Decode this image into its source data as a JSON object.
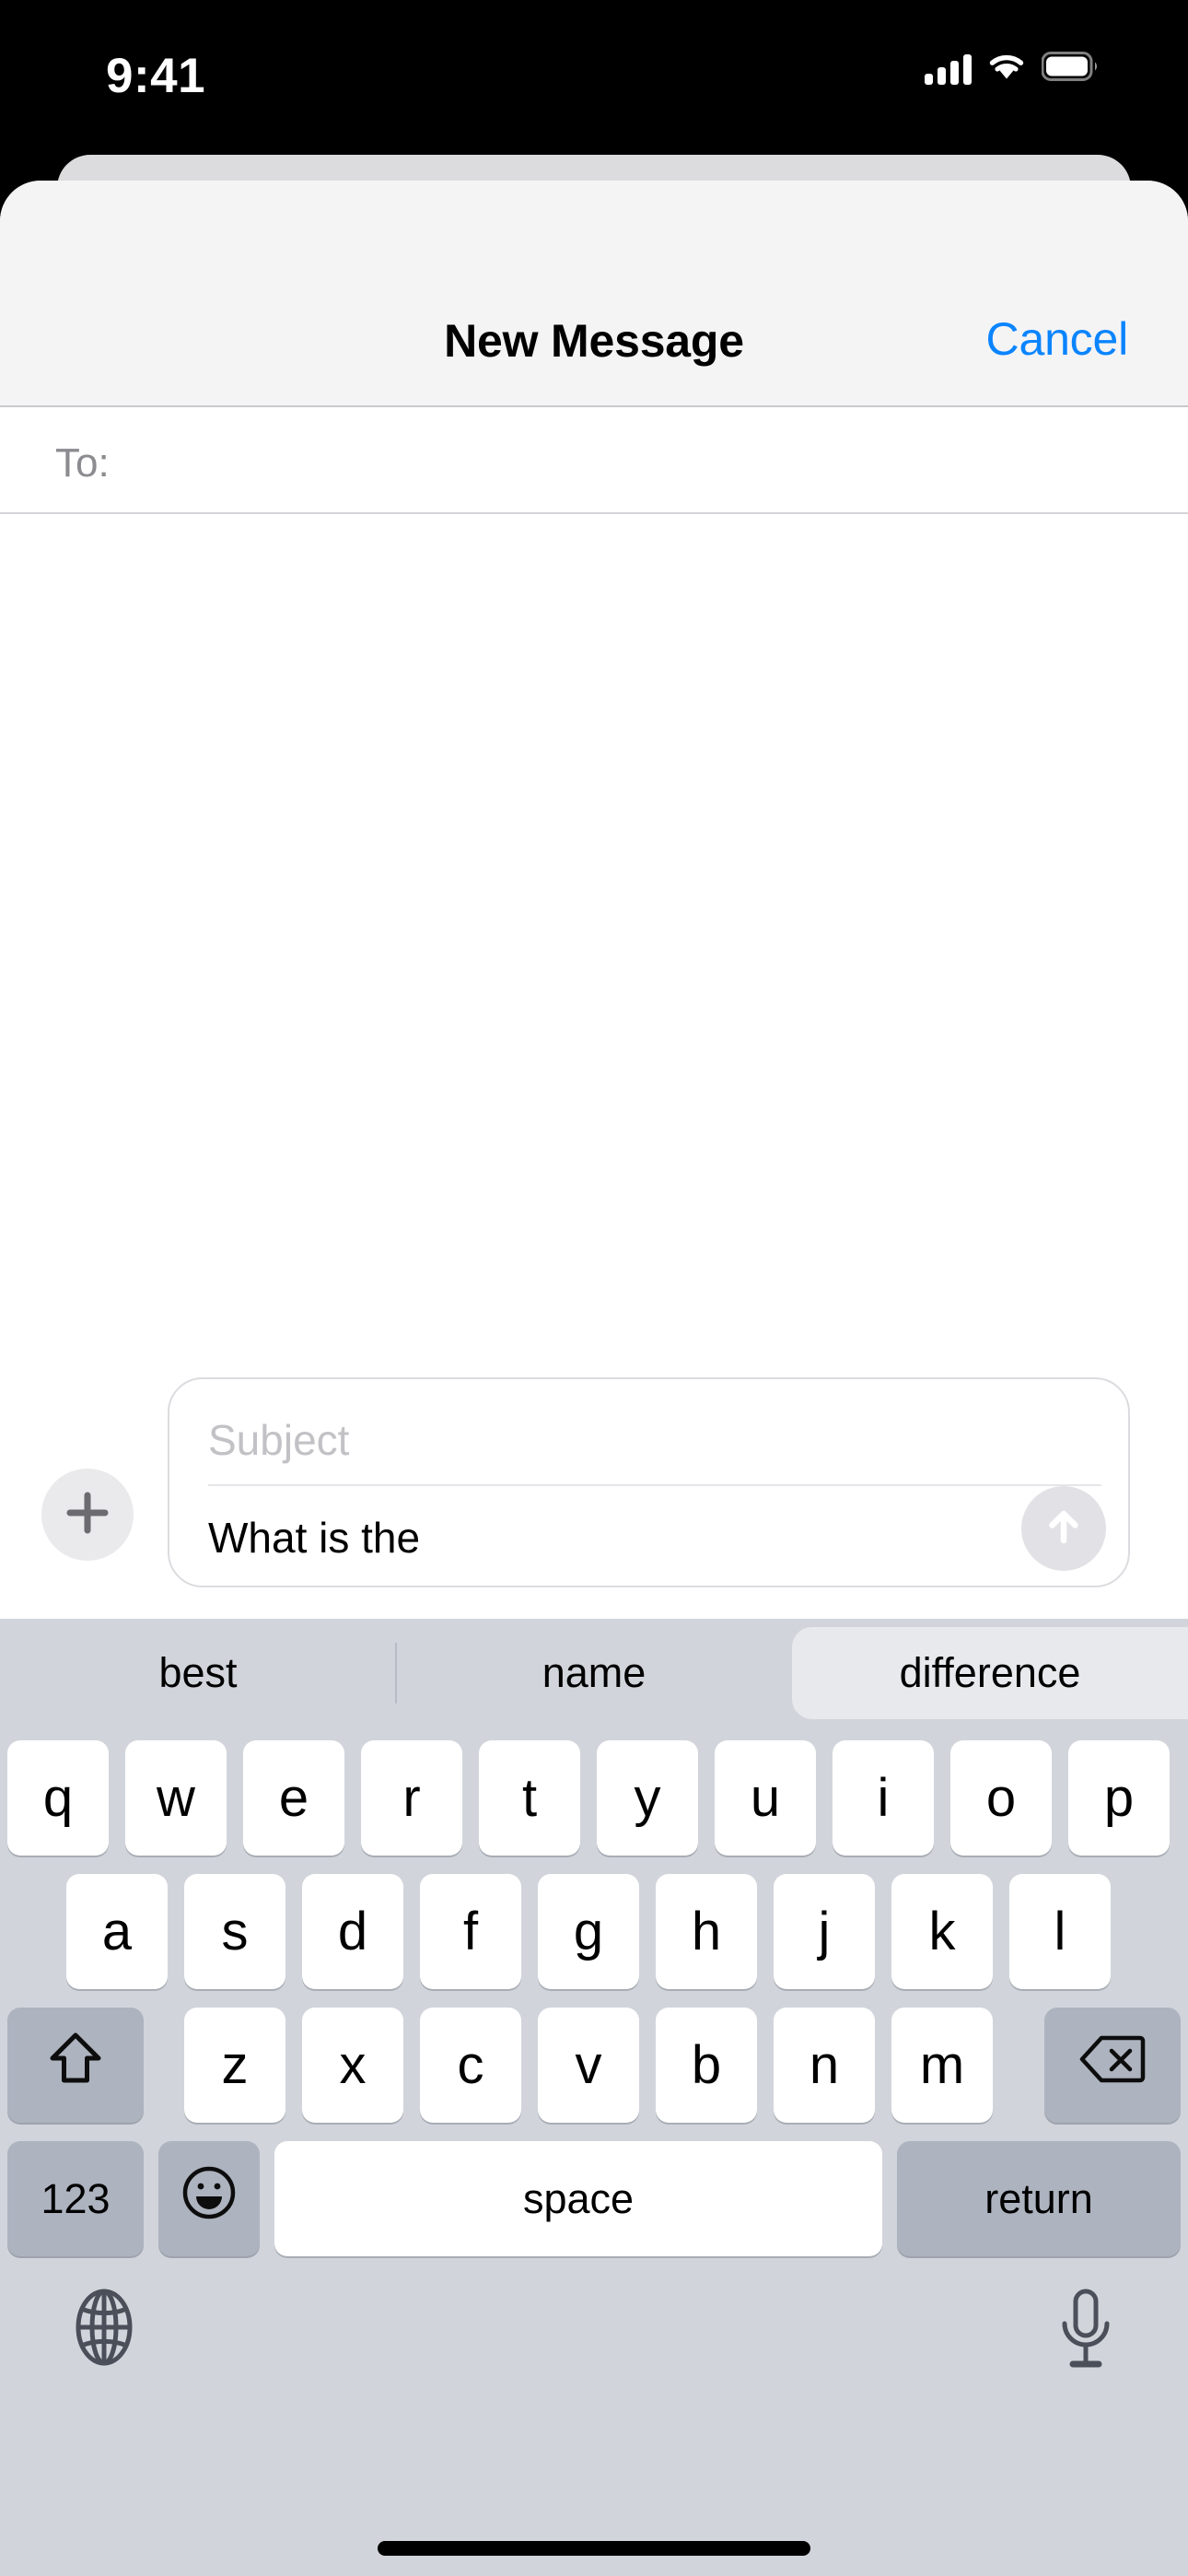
{
  "status_bar": {
    "time": "9:41",
    "cellular_icon": "cellular-signal-icon",
    "wifi_icon": "wifi-icon",
    "battery_icon": "battery-full-icon",
    "signal_bars": 4
  },
  "header": {
    "title": "New Message",
    "cancel_label": "Cancel",
    "accent_color": "#0a84ff",
    "background_color": "#f4f4f5"
  },
  "recipient": {
    "label": "To:",
    "value": "",
    "placeholder": "To:"
  },
  "compose": {
    "attach_icon": "plus-icon",
    "subject_placeholder": "Subject",
    "subject_value": "",
    "body_value": "What is the",
    "body_placeholder": "",
    "send_icon": "arrow-up-icon",
    "send_enabled": false,
    "send_button_color": "#e2e2e6",
    "attach_button_color": "#eaeaec"
  },
  "keyboard": {
    "background_color": "#d1d5db",
    "predictions": [
      {
        "text": "best",
        "selected": false
      },
      {
        "text": "name",
        "selected": false
      },
      {
        "text": "difference",
        "selected": true
      }
    ],
    "row1": [
      "q",
      "w",
      "e",
      "r",
      "t",
      "y",
      "u",
      "i",
      "o",
      "p"
    ],
    "row2": [
      "a",
      "s",
      "d",
      "f",
      "g",
      "h",
      "j",
      "k",
      "l"
    ],
    "row3": [
      "z",
      "x",
      "c",
      "v",
      "b",
      "n",
      "m"
    ],
    "shift_icon": "shift-arrow-up-icon",
    "backspace_icon": "delete-backward-icon",
    "numbers_label": "123",
    "emoji_icon": "smiley-face-icon",
    "space_label": "space",
    "return_label": "return",
    "globe_icon": "globe-icon",
    "dictation_icon": "microphone-icon"
  }
}
